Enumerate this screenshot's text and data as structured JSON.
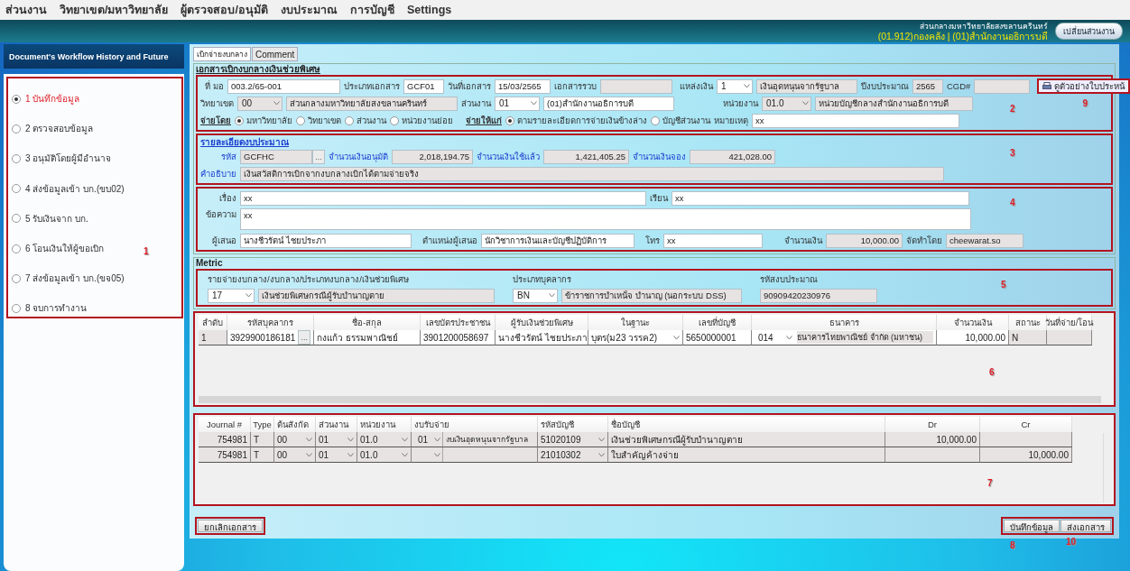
{
  "menu": [
    "ส่วนงาน",
    "วิทยาเขต/มหาวิทยาลัย",
    "ผู้ตรวจสอบ/อนุมัติ",
    "งบประมาณ",
    "การบัญชี",
    "Settings"
  ],
  "header": {
    "org": "ส่วนกลางมหาวิทยาลัยสงขลานครินทร์",
    "unit": "(01.912)กองคลัง | (01)สำนักงานอธิการบดี",
    "switch_button": "เปลี่ยนส่วนงาน"
  },
  "sidebar": {
    "title": "Document's Workflow History and Future",
    "annotation": "1",
    "steps": [
      {
        "label": "1 บันทึกข้อมูล",
        "selected": true
      },
      {
        "label": "2 ตรวจสอบข้อมูล",
        "selected": false
      },
      {
        "label": "3 อนุมัติโดยผู้มีอำนาจ",
        "selected": false
      },
      {
        "label": "4 ส่งข้อมูลเข้า บก.(ขบ02)",
        "selected": false
      },
      {
        "label": "5 รับเงินจาก บก.",
        "selected": false
      },
      {
        "label": "6 โอนเงินให้ผู้ขอเบิก",
        "selected": false
      },
      {
        "label": "7 ส่งข้อมูลเข้า บก.(ขจ05)",
        "selected": false
      },
      {
        "label": "8 จบการทำงาน",
        "selected": false
      }
    ]
  },
  "tabs": [
    {
      "label": "เบิกจ่ายงบกลาง",
      "selected": true
    },
    {
      "label": "Comment",
      "selected": false
    }
  ],
  "document": {
    "legend": "เอกสารเบิกงบกลางเงินช่วยพิเศษ",
    "annotation": "2",
    "doc_no": {
      "label": "ที่ มอ",
      "value": "003.2/65-001"
    },
    "doc_type": {
      "label": "ประเภทเอกสาร",
      "value": "GCF01"
    },
    "doc_date": {
      "label": "วันที่เอกสาร",
      "value": "15/03/2565"
    },
    "combined_doc": {
      "label": "เอกสารรวบ"
    },
    "fund_source": {
      "label": "แหล่งเงิน",
      "code": "1",
      "name": "เงินอุดหนุนจากรัฐบาล"
    },
    "fiscal_year": {
      "label": "ปีงบประมาณ",
      "value": "2565"
    },
    "cgd": {
      "label": "CGD#"
    },
    "preview_button": {
      "label": "ดูตัวอย่างใบประหน้",
      "annotation": "9"
    },
    "campus": {
      "label": "วิทยาเขต",
      "code": "00",
      "name": "ส่วนกลางมหาวิทยาลัยสงขลานครินทร์"
    },
    "division": {
      "label": "ส่วนงาน",
      "code": "01",
      "name": "(01)สำนักงานอธิการบดี"
    },
    "unit": {
      "label": "หน่วยงาน",
      "code": "01.0",
      "name": "หน่วยบัญชีกลางสำนักงานอธิการบดี"
    },
    "paid_by": {
      "label": "จ่ายโดย",
      "options": [
        {
          "label": "มหาวิทยาลัย",
          "selected": true
        },
        {
          "label": "วิทยาเขต",
          "selected": false
        },
        {
          "label": "ส่วนงาน",
          "selected": false
        },
        {
          "label": "หน่วยงานย่อย",
          "selected": false
        }
      ]
    },
    "paid_to": {
      "label": "จ่ายให้แก่",
      "options": [
        {
          "label": "ตามรายละเอียดการจ่ายเงินข้างล่าง",
          "selected": true
        },
        {
          "label": "บัญชีส่วนงาน",
          "selected": false
        }
      ]
    },
    "remark": {
      "label": "หมายเหตุ",
      "value": "xx"
    }
  },
  "budget": {
    "legend": "รายละเอียดงบประมาณ",
    "annotation": "3",
    "code": {
      "label": "รหัส",
      "value": "GCFHC",
      "lookup_button": "..."
    },
    "approved": {
      "label": "จำนวนเงินอนุมัติ",
      "value": "2,018,194.75"
    },
    "used": {
      "label": "จำนวนเงินใช้แล้ว",
      "value": "1,421,405.25"
    },
    "reserved": {
      "label": "จำนวนเงินจอง",
      "value": "421,028.00"
    },
    "description": {
      "label": "คำอธิบาย",
      "value": "เงินสวัสดิการเบิกจากงบกลางเบิกได้ตามจ่ายจริง"
    }
  },
  "memo": {
    "annotation": "4",
    "subject": {
      "label": "เรื่อง",
      "value": "xx"
    },
    "to": {
      "label": "เรียน",
      "value": "xx"
    },
    "message": {
      "label": "ข้อความ",
      "value": "xx"
    },
    "proposer": {
      "label": "ผู้เสนอ",
      "value": "นางชีวรัตน์  ไชยประภา"
    },
    "position": {
      "label": "ตำแหน่งผู้เสนอ",
      "value": "นักวิชาการเงินและบัญชีปฏิบัติการ"
    },
    "phone": {
      "label": "โทร",
      "value": "xx"
    },
    "amount": {
      "label": "จำนวนเงิน",
      "value": "10,000.00"
    },
    "prepared_by": {
      "label": "จัดทำโดย",
      "value": "cheewarat.so"
    }
  },
  "metric": {
    "legend": "Metric",
    "annotation": "5",
    "expense_type": {
      "label": "รายจ่ายงบกลาง/งบกลาง/ประเภทงบกลาง/เงินช่วยพิเศษ",
      "code": "17",
      "name": "เงินช่วยพิเศษกรณีผู้รับบำนาญตาย"
    },
    "personnel_type": {
      "label": "ประเภทบุคลากร",
      "code": "BN",
      "name": "ข้าราชการบำเหน็จ บำนาญ (นอกระบบ DSS)"
    },
    "budget_code": {
      "label": "รหัสงบประมาณ",
      "value": "90909420230976"
    }
  },
  "payees": {
    "annotation": "6",
    "columns": [
      "ลำดับ",
      "รหัสบุคลากร",
      "ชื่อ-สกุล",
      "เลขบัตรประชาชน",
      "ผู้รับเงินช่วยพิเศษ",
      "ในฐานะ",
      "เลขที่บัญชี",
      "ธนาคาร",
      "จำนวนเงิน",
      "สถานะ",
      "วันที่จ่าย/โอน"
    ],
    "rows": [
      {
        "no": "1",
        "staff_id": "3929900186181",
        "lookup_button": "...",
        "name": "กงแก้ว  ธรรมพาณิชย์",
        "citizen_id": "3901200058697",
        "recipient": "นางชีวรัตน์ ไชยประภา",
        "relation": "บุตร(ม23 วรรค2)",
        "account_no": "5650000001",
        "bank_code": "014",
        "bank_name": "ธนาคารไทยพาณิชย์ จำกัด (มหาชน)",
        "amount": "10,000.00",
        "status": "N"
      }
    ]
  },
  "journal": {
    "annotation": "7",
    "columns": [
      "Journal #",
      "Type",
      "ต้นสังกัด",
      "ส่วนงาน",
      "หน่วยงาน",
      "งบรับจ่าย",
      "รหัสบัญชี",
      "ชื่อบัญชี",
      "Dr",
      "Cr"
    ],
    "rows": [
      {
        "journal": "754981",
        "type": "T",
        "org": "00",
        "division": "01",
        "unit": "01.0",
        "budget_code": "01",
        "budget_name": "งบเงินอุดหนุนจากรัฐบาล",
        "account_code": "51020109",
        "account_name": "เงินช่วยพิเศษกรณีผู้รับบำนาญตาย",
        "dr": "10,000.00"
      },
      {
        "journal": "754981",
        "type": "T",
        "org": "00",
        "division": "01",
        "unit": "01.0",
        "account_code": "21010302",
        "account_name": "ใบสำคัญค้างจ่าย",
        "cr": "10,000.00"
      }
    ]
  },
  "actions": {
    "cancel": {
      "label": "ยกเลิกเอกสาร"
    },
    "save": {
      "label": "บันทึกข้อมูล",
      "annotation": "8"
    },
    "send": {
      "label": "ส่งเอกสาร",
      "annotation": "10"
    }
  }
}
